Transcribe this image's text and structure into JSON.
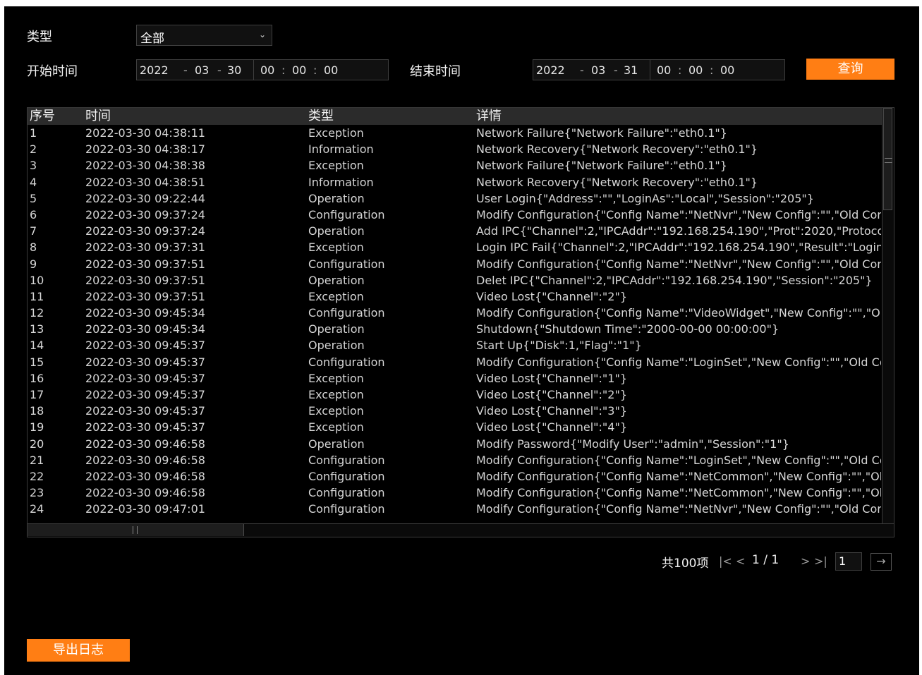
{
  "filters": {
    "type_label": "类型",
    "type_value": "全部",
    "start_label": "开始时间",
    "end_label": "结束时间",
    "start": {
      "year": "2022",
      "month": "03",
      "day": "30",
      "hour": "00",
      "minute": "00",
      "second": "00"
    },
    "end": {
      "year": "2022",
      "month": "03",
      "day": "31",
      "hour": "00",
      "minute": "00",
      "second": "00"
    },
    "query_label": "查询"
  },
  "table": {
    "headers": {
      "no": "序号",
      "time": "时间",
      "type": "类型",
      "detail": "详情"
    },
    "rows": [
      {
        "no": "1",
        "time": "2022-03-30 04:38:11",
        "type": "Exception",
        "detail": "Network Failure{\"Network Failure\":\"eth0.1\"}"
      },
      {
        "no": "2",
        "time": "2022-03-30 04:38:17",
        "type": "Information",
        "detail": "Network Recovery{\"Network Recovery\":\"eth0.1\"}"
      },
      {
        "no": "3",
        "time": "2022-03-30 04:38:38",
        "type": "Exception",
        "detail": "Network Failure{\"Network Failure\":\"eth0.1\"}"
      },
      {
        "no": "4",
        "time": "2022-03-30 04:38:51",
        "type": "Information",
        "detail": "Network Recovery{\"Network Recovery\":\"eth0.1\"}"
      },
      {
        "no": "5",
        "time": "2022-03-30 09:22:44",
        "type": "Operation",
        "detail": "User Login{\"Address\":\"\",\"LoginAs\":\"Local\",\"Session\":\"205\"}"
      },
      {
        "no": "6",
        "time": "2022-03-30 09:37:24",
        "type": "Configuration",
        "detail": "Modify Configuration{\"Config Name\":\"NetNvr\",\"New Config\":\"\",\"Old Cor"
      },
      {
        "no": "7",
        "time": "2022-03-30 09:37:24",
        "type": "Operation",
        "detail": "Add IPC{\"Channel\":2,\"IPCAddr\":\"192.168.254.190\",\"Prot\":2020,\"Protoco"
      },
      {
        "no": "8",
        "time": "2022-03-30 09:37:31",
        "type": "Exception",
        "detail": "Login IPC Fail{\"Channel\":2,\"IPCAddr\":\"192.168.254.190\",\"Result\":\"Login"
      },
      {
        "no": "9",
        "time": "2022-03-30 09:37:51",
        "type": "Configuration",
        "detail": "Modify Configuration{\"Config Name\":\"NetNvr\",\"New Config\":\"\",\"Old Cor"
      },
      {
        "no": "10",
        "time": "2022-03-30 09:37:51",
        "type": "Operation",
        "detail": "Delet IPC{\"Channel\":2,\"IPCAddr\":\"192.168.254.190\",\"Session\":\"205\"}"
      },
      {
        "no": "11",
        "time": "2022-03-30 09:37:51",
        "type": "Exception",
        "detail": "Video Lost{\"Channel\":\"2\"}"
      },
      {
        "no": "12",
        "time": "2022-03-30 09:45:34",
        "type": "Configuration",
        "detail": "Modify Configuration{\"Config Name\":\"VideoWidget\",\"New Config\":\"\",\"O"
      },
      {
        "no": "13",
        "time": "2022-03-30 09:45:34",
        "type": "Operation",
        "detail": "Shutdown{\"Shutdown Time\":\"2000-00-00 00:00:00\"}"
      },
      {
        "no": "14",
        "time": "2022-03-30 09:45:37",
        "type": "Operation",
        "detail": "Start Up{\"Disk\":1,\"Flag\":\"1\"}"
      },
      {
        "no": "15",
        "time": "2022-03-30 09:45:37",
        "type": "Configuration",
        "detail": "Modify Configuration{\"Config Name\":\"LoginSet\",\"New Config\":\"\",\"Old Co"
      },
      {
        "no": "16",
        "time": "2022-03-30 09:45:37",
        "type": "Exception",
        "detail": "Video Lost{\"Channel\":\"1\"}"
      },
      {
        "no": "17",
        "time": "2022-03-30 09:45:37",
        "type": "Exception",
        "detail": "Video Lost{\"Channel\":\"2\"}"
      },
      {
        "no": "18",
        "time": "2022-03-30 09:45:37",
        "type": "Exception",
        "detail": "Video Lost{\"Channel\":\"3\"}"
      },
      {
        "no": "19",
        "time": "2022-03-30 09:45:37",
        "type": "Exception",
        "detail": "Video Lost{\"Channel\":\"4\"}"
      },
      {
        "no": "20",
        "time": "2022-03-30 09:46:58",
        "type": "Operation",
        "detail": "Modify Password{\"Modify User\":\"admin\",\"Session\":\"1\"}"
      },
      {
        "no": "21",
        "time": "2022-03-30 09:46:58",
        "type": "Configuration",
        "detail": "Modify Configuration{\"Config Name\":\"LoginSet\",\"New Config\":\"\",\"Old Co"
      },
      {
        "no": "22",
        "time": "2022-03-30 09:46:58",
        "type": "Configuration",
        "detail": "Modify Configuration{\"Config Name\":\"NetCommon\",\"New Config\":\"\",\"Ol"
      },
      {
        "no": "23",
        "time": "2022-03-30 09:46:58",
        "type": "Configuration",
        "detail": "Modify Configuration{\"Config Name\":\"NetCommon\",\"New Config\":\"\",\"Ol"
      },
      {
        "no": "24",
        "time": "2022-03-30 09:47:01",
        "type": "Configuration",
        "detail": "Modify Configuration{\"Config Name\":\"NetNvr\",\"New Config\":\"\",\"Old Cor"
      }
    ]
  },
  "pager": {
    "total": "共100项",
    "page": "1 / 1",
    "page_input": "1",
    "icons": {
      "first": "first-page-icon",
      "prev": "prev-page-icon",
      "next": "next-page-icon",
      "last": "last-page-icon",
      "go": "go-arrow-icon"
    }
  },
  "export_label": "导出日志",
  "colors": {
    "accent": "#ff7e14",
    "background": "#000000",
    "header": "#2b2b2b"
  }
}
